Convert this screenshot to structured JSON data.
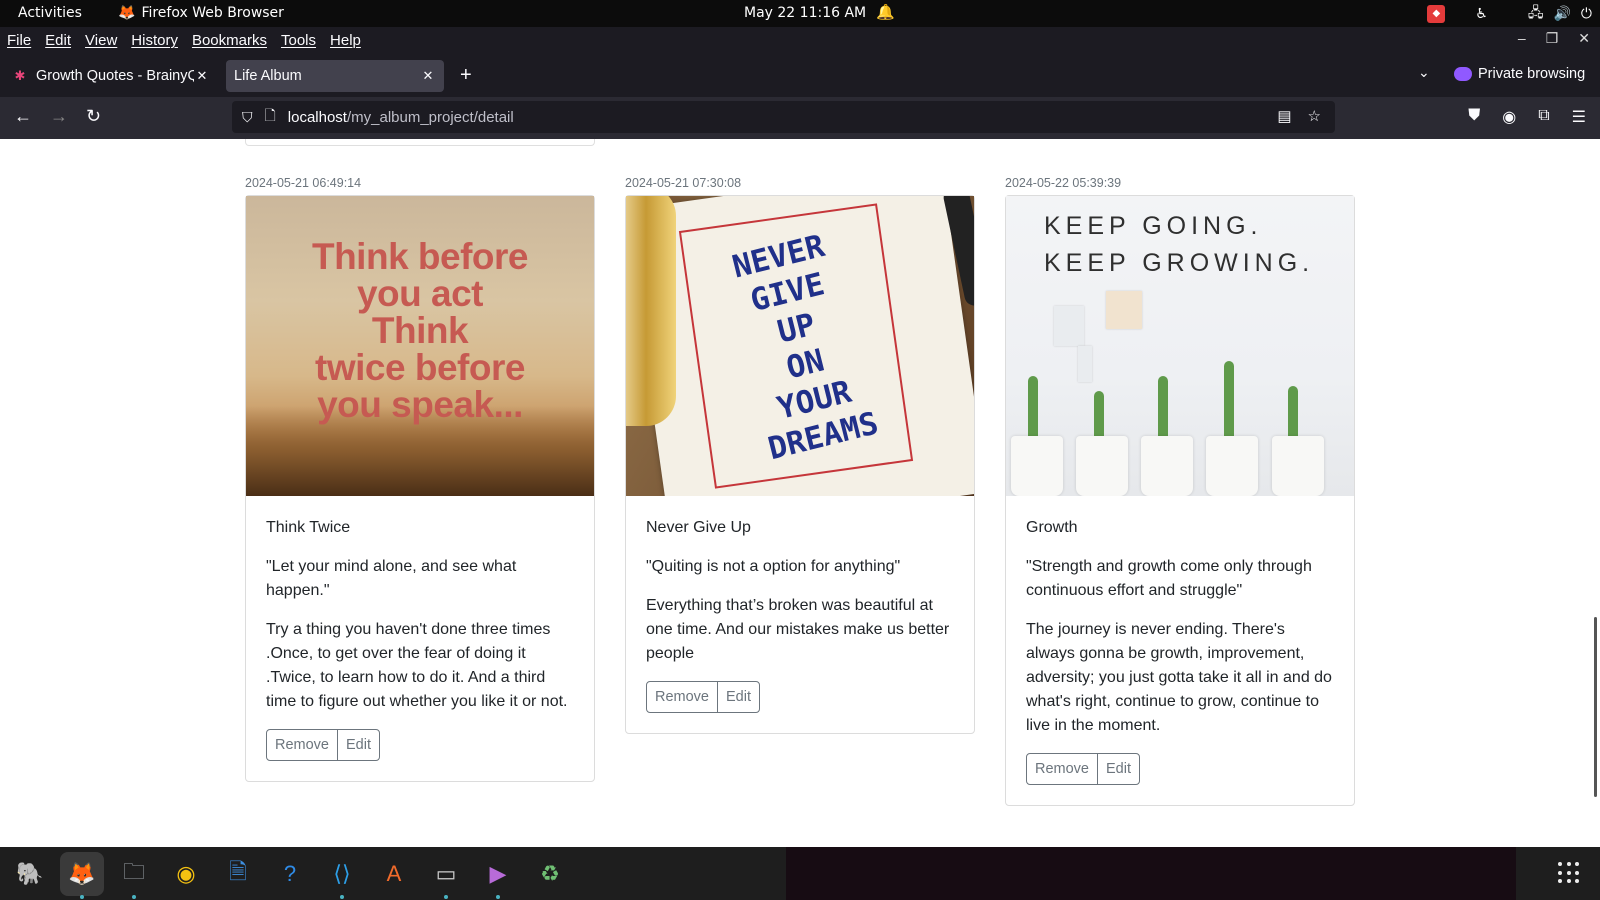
{
  "system_bar": {
    "activities": "Activities",
    "app_name": "Firefox Web Browser",
    "clock": "May 22  11:16 AM"
  },
  "menu": {
    "items": [
      "File",
      "Edit",
      "View",
      "History",
      "Bookmarks",
      "Tools",
      "Help"
    ]
  },
  "tabs": [
    {
      "title": "Growth Quotes - BrainyQuote",
      "active": false
    },
    {
      "title": "Life Album",
      "active": true
    }
  ],
  "private_label": "Private browsing",
  "url": {
    "host": "localhost",
    "path": "/my_album_project/detail"
  },
  "cards": [
    {
      "date": "2024-05-21 06:49:14",
      "image_text": "Think before you act Think twice before you speak...",
      "title": "Think Twice",
      "quote": "\"Let your mind alone, and see what happen.\"",
      "description": "Try a thing you haven't done three times .Once, to get over the fear of doing it .Twice, to learn how to do it. And a third time to figure out whether you like it or not.",
      "remove_label": "Remove",
      "edit_label": "Edit"
    },
    {
      "date": "2024-05-21 07:30:08",
      "image_text": "NEVER GIVE UP ON YOUR DREAMS",
      "title": "Never Give Up",
      "quote": "\"Quiting is not a option for anything\"",
      "description": "Everything that’s broken was beautiful at one time. And our mistakes make us better people",
      "remove_label": "Remove",
      "edit_label": "Edit"
    },
    {
      "date": "2024-05-22 05:39:39",
      "image_text": "KEEP GOING. KEEP GROWING.",
      "title": "Growth",
      "quote": "\"Strength and growth come only through continuous effort and struggle\"",
      "description": "The journey is never ending. There's always gonna be growth, improvement, adversity; you just gotta take it all in and do what's right, continue to grow, continue to live in the moment.",
      "remove_label": "Remove",
      "edit_label": "Edit"
    }
  ],
  "dock": {
    "apps": [
      "pgadmin-icon",
      "firefox-icon",
      "files-icon",
      "rhythmbox-icon",
      "text-editor-icon",
      "help-icon",
      "vscode-icon",
      "app-center-icon",
      "terminal-icon",
      "video-player-icon",
      "trash-icon"
    ]
  },
  "colors": {
    "accent_private": "#9059ff",
    "chrome_dark": "#1c1b22",
    "toolbar": "#2b2a33"
  }
}
